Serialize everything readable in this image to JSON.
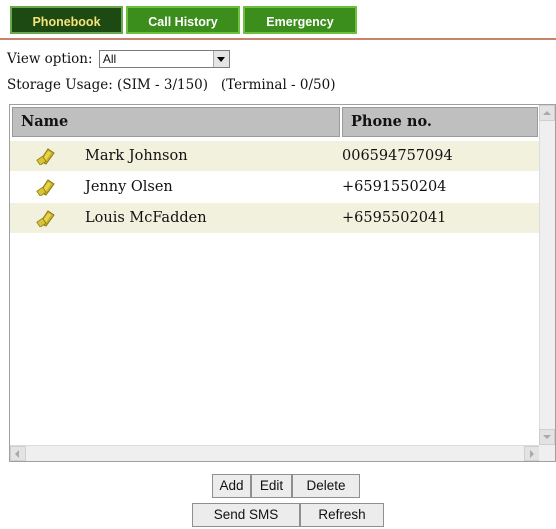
{
  "tabs": [
    {
      "label": "Phonebook",
      "active": true
    },
    {
      "label": "Call History",
      "active": false
    },
    {
      "label": "Emergency",
      "active": false
    }
  ],
  "view_option": {
    "label": "View option:",
    "selected": "All"
  },
  "storage": {
    "text": "Storage Usage: (SIM - 3/150)   (Terminal - 0/50)"
  },
  "table": {
    "columns": [
      "Name",
      "Phone no."
    ],
    "rows": [
      {
        "icon": "sim-card-icon",
        "name": "Mark Johnson",
        "phone": "006594757094"
      },
      {
        "icon": "sim-card-icon",
        "name": "Jenny Olsen",
        "phone": "+6591550204"
      },
      {
        "icon": "sim-card-icon",
        "name": "Louis McFadden",
        "phone": "+6595502041"
      }
    ]
  },
  "buttons": {
    "add": "Add",
    "edit": "Edit",
    "delete": "Delete",
    "send_sms": "Send SMS",
    "refresh": "Refresh"
  },
  "colors": {
    "tab_active_bg": "#1d4a12",
    "tab_active_text": "#f4e27a",
    "tab_inactive_bg": "#3c8e1c",
    "header_bg": "#bfbfbf",
    "row_shade": "#f1f1de"
  }
}
